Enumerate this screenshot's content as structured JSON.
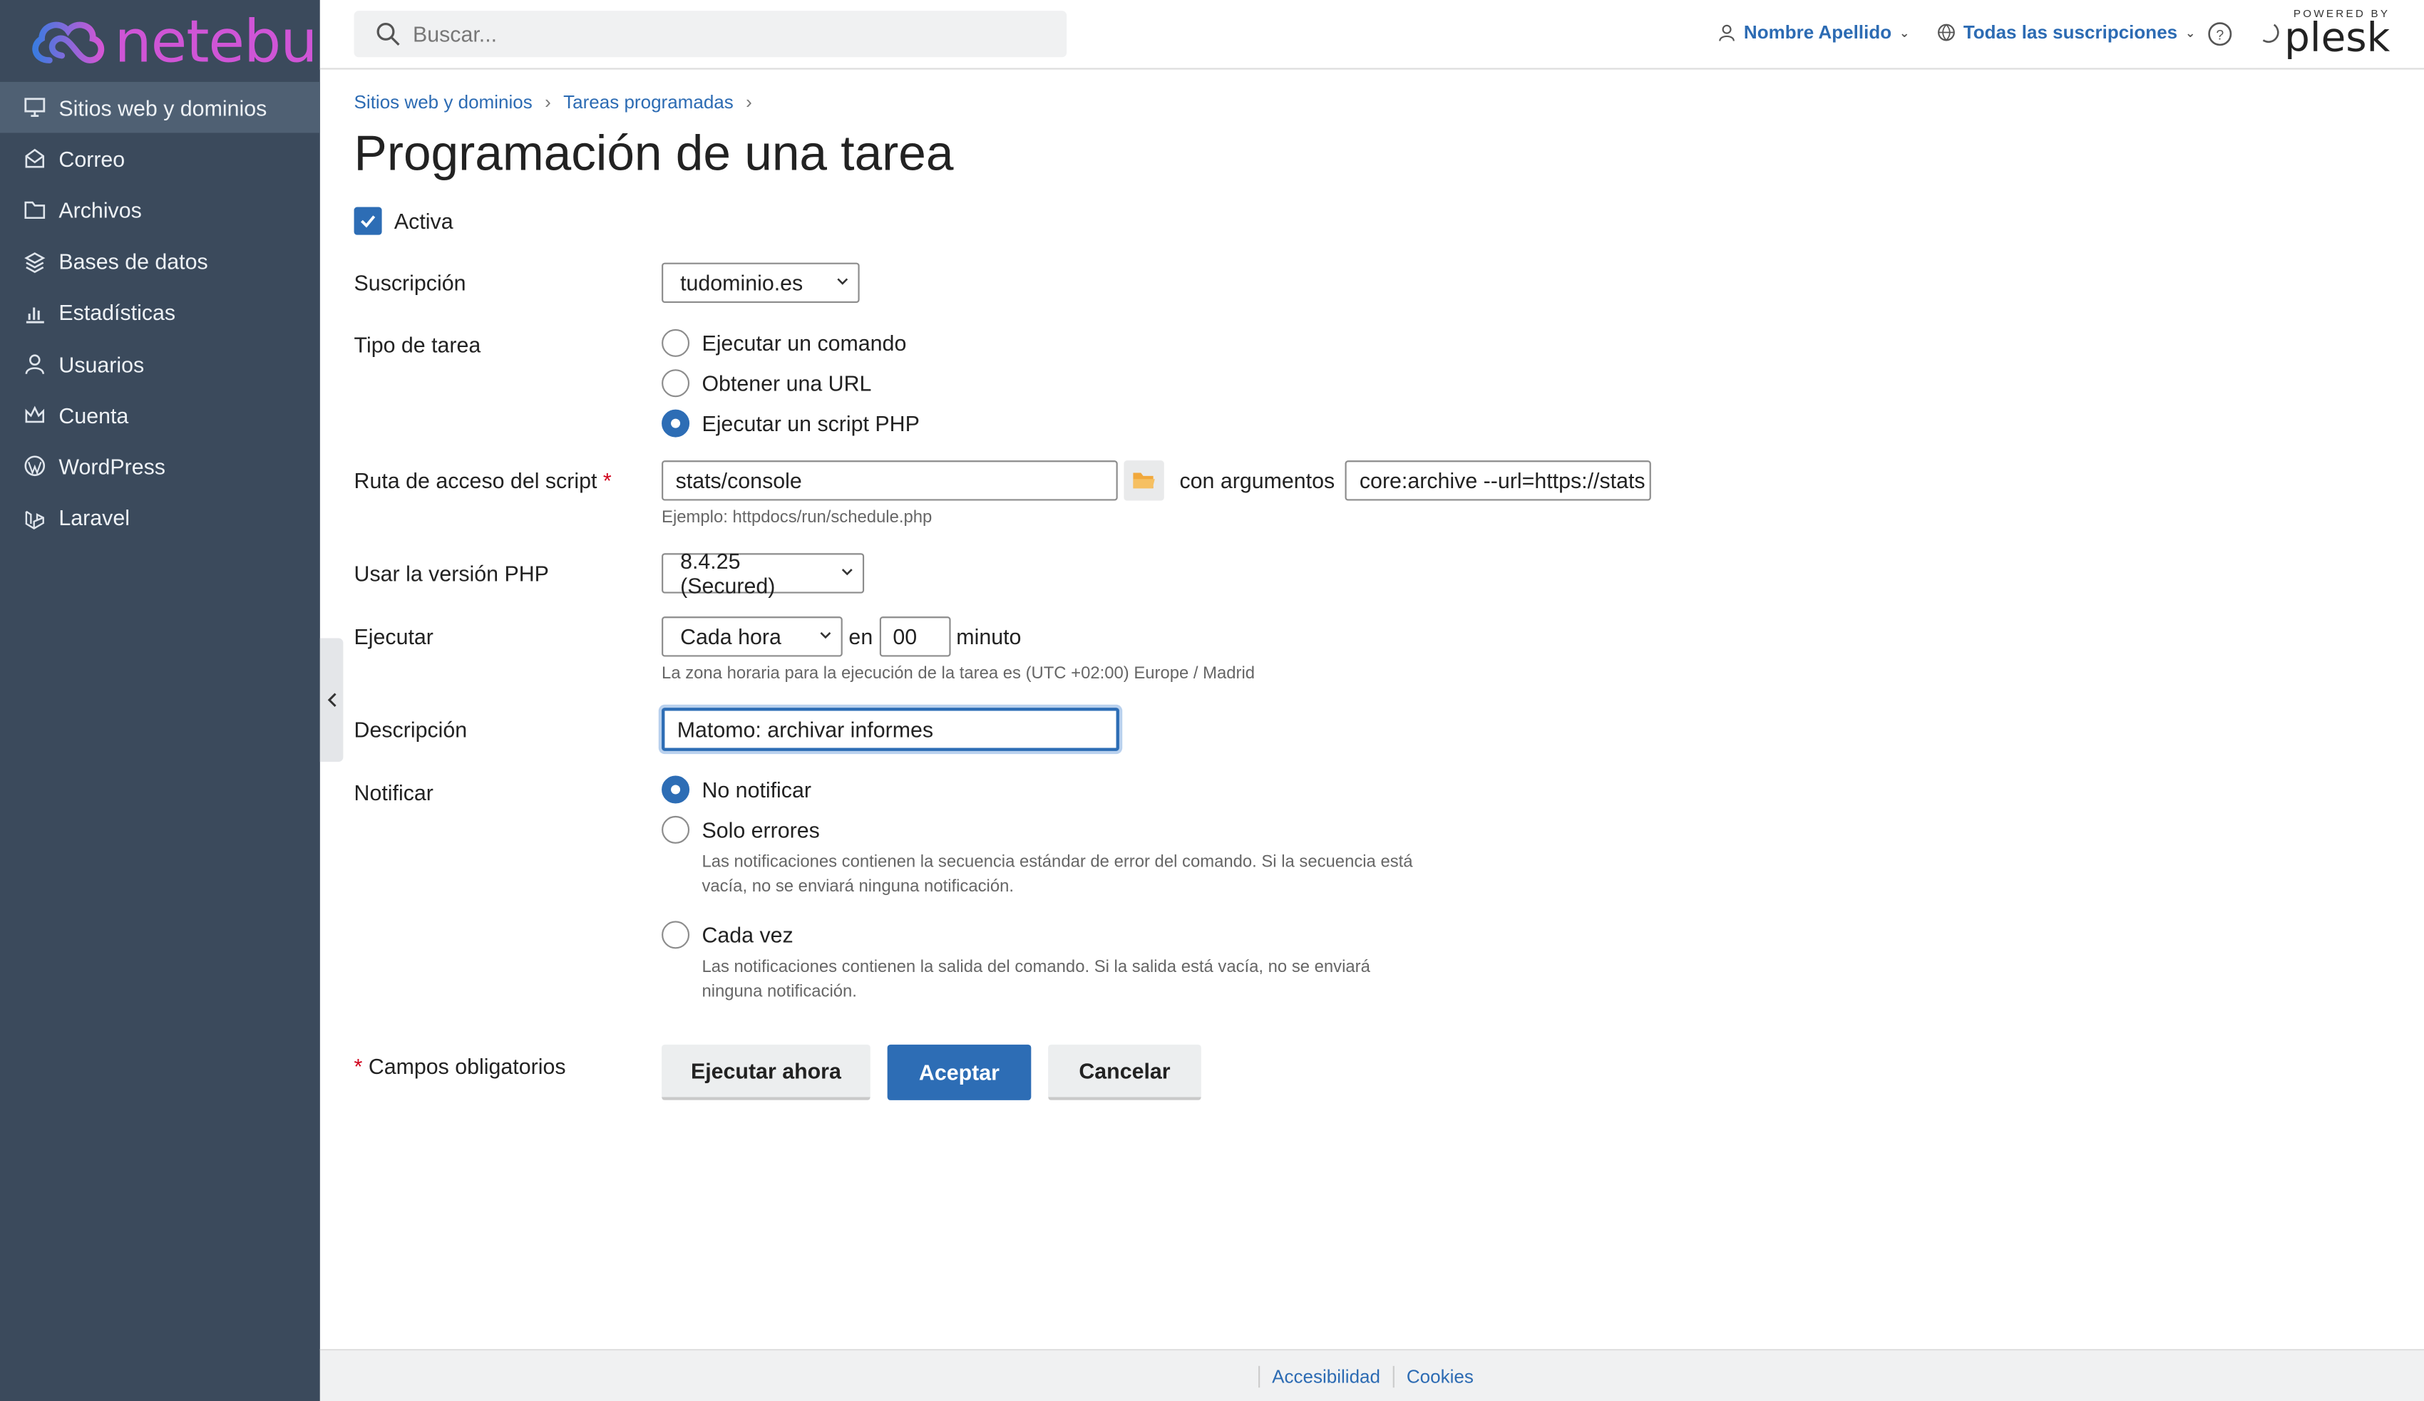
{
  "brand": {
    "logo_text": "netebu",
    "powered_by": "POWERED BY",
    "plesk": "plesk"
  },
  "sidebar": {
    "items": [
      {
        "label": "Sitios web y dominios",
        "icon": "monitor-icon",
        "active": true
      },
      {
        "label": "Correo",
        "icon": "mail-icon"
      },
      {
        "label": "Archivos",
        "icon": "folder-icon"
      },
      {
        "label": "Bases de datos",
        "icon": "database-icon"
      },
      {
        "label": "Estadísticas",
        "icon": "bar-chart-icon"
      },
      {
        "label": "Usuarios",
        "icon": "user-icon"
      },
      {
        "label": "Cuenta",
        "icon": "crown-icon"
      },
      {
        "label": "WordPress",
        "icon": "wordpress-icon"
      },
      {
        "label": "Laravel",
        "icon": "laravel-icon"
      }
    ]
  },
  "topbar": {
    "search_placeholder": "Buscar...",
    "user": "Nombre Apellido",
    "subscriptions": "Todas las suscripciones"
  },
  "breadcrumb": [
    "Sitios web y dominios",
    "Tareas programadas"
  ],
  "page_title": "Programación de una tarea",
  "form": {
    "active_label": "Activa",
    "subscription_label": "Suscripción",
    "subscription_value": "tudominio.es",
    "task_type_label": "Tipo de tarea",
    "task_types": [
      "Ejecutar un comando",
      "Obtener una URL",
      "Ejecutar un script PHP"
    ],
    "task_type_selected": 2,
    "script_label": "Ruta de acceso del script",
    "required_mark": "*",
    "script_value": "stats/console",
    "args_label": "con argumentos",
    "args_value": "core:archive --url=https://stats",
    "script_hint": "Ejemplo: httpdocs/run/schedule.php",
    "php_label": "Usar la versión PHP",
    "php_value": "8.4.25 (Secured)",
    "run_label": "Ejecutar",
    "run_value": "Cada hora",
    "run_en": "en",
    "run_minute_value": "00",
    "run_minute_label": "minuto",
    "timezone_hint": "La zona horaria para la ejecución de la tarea es (UTC +02:00) Europe / Madrid",
    "description_label": "Descripción",
    "description_value": "Matomo: archivar informes",
    "notify_label": "Notificar",
    "notify_options": [
      {
        "label": "No notificar",
        "hint": ""
      },
      {
        "label": "Solo errores",
        "hint": "Las notificaciones contienen la secuencia estándar de error del comando. Si la secuencia está vacía, no se enviará ninguna notificación."
      },
      {
        "label": "Cada vez",
        "hint": "Las notificaciones contienen la salida del comando. Si la salida está vacía, no se enviará ninguna notificación."
      }
    ],
    "notify_selected": 0,
    "required_fields": "Campos obligatorios",
    "btn_run_now": "Ejecutar ahora",
    "btn_accept": "Aceptar",
    "btn_cancel": "Cancelar"
  },
  "footer": {
    "links": [
      "Accesibilidad",
      "Cookies"
    ]
  },
  "colors": {
    "sidebar_bg": "#3b4a5c",
    "primary": "#2d6db5",
    "link": "#2c6bb3",
    "brand_gradient_from": "#3c7be0",
    "brand_gradient_to": "#d256d4"
  }
}
